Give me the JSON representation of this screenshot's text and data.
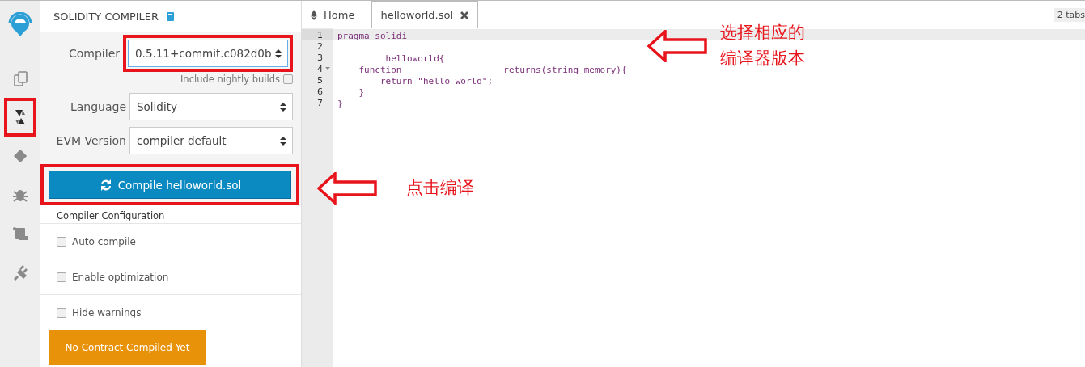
{
  "rail": {
    "logo": {
      "kind": "logo"
    },
    "items": [
      {
        "kind": "files",
        "selected": false,
        "highlighted": false
      },
      {
        "kind": "solidity",
        "selected": true,
        "highlighted": true
      },
      {
        "kind": "deploy",
        "selected": false,
        "highlighted": false
      },
      {
        "kind": "debug",
        "selected": false,
        "highlighted": false
      },
      {
        "kind": "scroll",
        "selected": false,
        "highlighted": false
      },
      {
        "kind": "plugin",
        "selected": false,
        "highlighted": false
      }
    ]
  },
  "panel": {
    "title": "SOLIDITY COMPILER",
    "fields": [
      {
        "label": "Compiler",
        "value": "0.5.11+commit.c082d0b",
        "highlighted": true,
        "focused": true
      },
      {
        "label": "Language",
        "value": "Solidity",
        "highlighted": false,
        "focused": false
      },
      {
        "label": "EVM Version",
        "value": "compiler default",
        "highlighted": false,
        "focused": false
      }
    ],
    "nightly": {
      "label": "Include nightly builds",
      "checked": false
    },
    "compile_button": {
      "label": "Compile helloworld.sol",
      "highlighted": true
    },
    "config_title": "Compiler Configuration",
    "options": [
      {
        "label": "Auto compile",
        "checked": false
      },
      {
        "label": "Enable optimization",
        "checked": false
      },
      {
        "label": "Hide warnings",
        "checked": false
      }
    ],
    "status_button": "No Contract Compiled Yet"
  },
  "editor": {
    "tabs": [
      {
        "label": "Home",
        "kind": "home",
        "selected": false
      },
      {
        "label": "helloworld.sol",
        "kind": "file",
        "selected": true
      }
    ],
    "tab_count": "2 tabs",
    "lines": [
      {
        "number": "1",
        "code": "pragma solidi",
        "fold": false,
        "current": true
      },
      {
        "number": "2",
        "fold": false,
        "current": false
      },
      {
        "number": "3",
        "code": "         helloworld{",
        "fold": false,
        "current": false
      },
      {
        "number": "4",
        "code": "    function                   returns(string memory){",
        "fold": true,
        "current": false
      },
      {
        "number": "5",
        "code": "        return \"hello world\";",
        "fold": false,
        "current": false
      },
      {
        "number": "6",
        "code": "    }",
        "fold": false,
        "current": false
      },
      {
        "number": "7",
        "code": "}",
        "fold": false,
        "current": false
      }
    ]
  },
  "annotations": [
    {
      "lines": [
        "选择相应的",
        "编译器版本"
      ],
      "kind": "version"
    },
    {
      "lines": [
        "点击编译"
      ],
      "kind": "compile"
    }
  ]
}
